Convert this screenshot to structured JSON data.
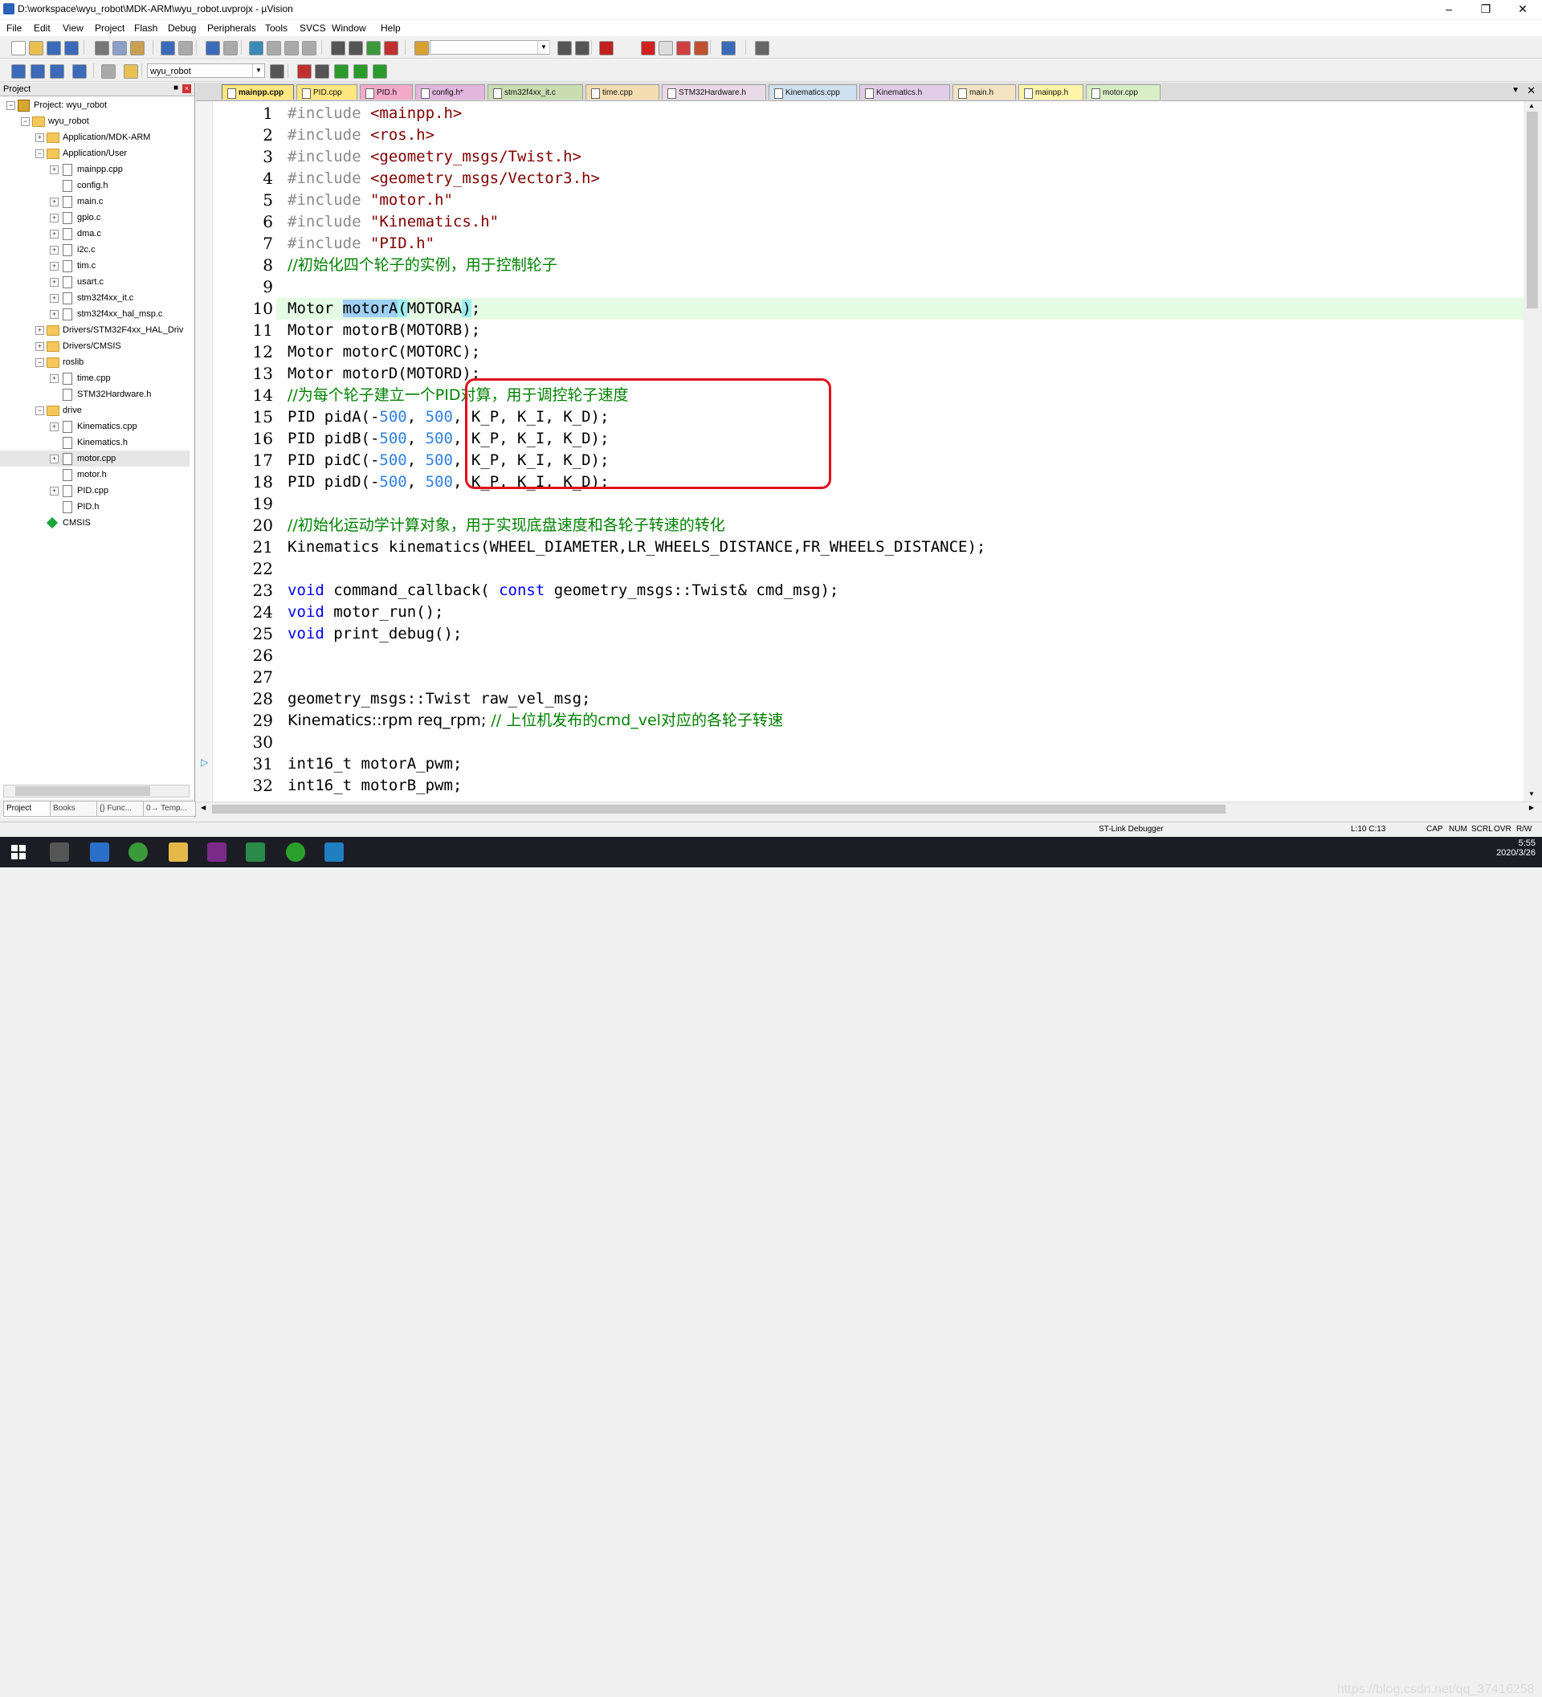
{
  "window": {
    "title": "D:\\workspace\\wyu_robot\\MDK-ARM\\wyu_robot.uvprojx - µVision"
  },
  "menu": [
    "File",
    "Edit",
    "View",
    "Project",
    "Flash",
    "Debug",
    "Peripherals",
    "Tools",
    "SVCS",
    "Window",
    "Help"
  ],
  "toolbar": {
    "target": "wyu_robot"
  },
  "project": {
    "header": "Project",
    "tree": [
      {
        "label": "Project: wyu_robot",
        "level": 0,
        "type": "project",
        "exp": "-"
      },
      {
        "label": "wyu_robot",
        "level": 1,
        "type": "folder",
        "exp": "-"
      },
      {
        "label": "Application/MDK-ARM",
        "level": 2,
        "type": "folder",
        "exp": "+"
      },
      {
        "label": "Application/User",
        "level": 2,
        "type": "folder",
        "exp": "-"
      },
      {
        "label": "mainpp.cpp",
        "level": 3,
        "type": "file",
        "exp": "+"
      },
      {
        "label": "config.h",
        "level": 3,
        "type": "file",
        "exp": ""
      },
      {
        "label": "main.c",
        "level": 3,
        "type": "file",
        "exp": "+"
      },
      {
        "label": "gpio.c",
        "level": 3,
        "type": "file",
        "exp": "+"
      },
      {
        "label": "dma.c",
        "level": 3,
        "type": "file",
        "exp": "+"
      },
      {
        "label": "i2c.c",
        "level": 3,
        "type": "file",
        "exp": "+"
      },
      {
        "label": "tim.c",
        "level": 3,
        "type": "file",
        "exp": "+"
      },
      {
        "label": "usart.c",
        "level": 3,
        "type": "file",
        "exp": "+"
      },
      {
        "label": "stm32f4xx_it.c",
        "level": 3,
        "type": "file",
        "exp": "+"
      },
      {
        "label": "stm32f4xx_hal_msp.c",
        "level": 3,
        "type": "file",
        "exp": "+"
      },
      {
        "label": "Drivers/STM32F4xx_HAL_Driv",
        "level": 2,
        "type": "folder",
        "exp": "+"
      },
      {
        "label": "Drivers/CMSIS",
        "level": 2,
        "type": "folder",
        "exp": "+"
      },
      {
        "label": "roslib",
        "level": 2,
        "type": "folder",
        "exp": "-"
      },
      {
        "label": "time.cpp",
        "level": 3,
        "type": "file",
        "exp": "+"
      },
      {
        "label": "STM32Hardware.h",
        "level": 3,
        "type": "file",
        "exp": ""
      },
      {
        "label": "drive",
        "level": 2,
        "type": "folder",
        "exp": "-"
      },
      {
        "label": "Kinematics.cpp",
        "level": 3,
        "type": "file",
        "exp": "+"
      },
      {
        "label": "Kinematics.h",
        "level": 3,
        "type": "file",
        "exp": ""
      },
      {
        "label": "motor.cpp",
        "level": 3,
        "type": "file",
        "exp": "+",
        "selected": true
      },
      {
        "label": "motor.h",
        "level": 3,
        "type": "file",
        "exp": ""
      },
      {
        "label": "PID.cpp",
        "level": 3,
        "type": "file",
        "exp": "+"
      },
      {
        "label": "PID.h",
        "level": 3,
        "type": "file",
        "exp": ""
      },
      {
        "label": "CMSIS",
        "level": 2,
        "type": "gem",
        "exp": ""
      }
    ],
    "tabs": [
      "Project",
      "Books",
      "{} Func...",
      "0→ Temp..."
    ]
  },
  "file_tabs": [
    {
      "label": "mainpp.cpp",
      "color": "#ffe680",
      "active": true
    },
    {
      "label": "PID.cpp",
      "color": "#ffe680"
    },
    {
      "label": "PID.h",
      "color": "#f5a9c8"
    },
    {
      "label": "config.h*",
      "color": "#e2b6de"
    },
    {
      "label": "stm32f4xx_it.c",
      "color": "#c9ddb0"
    },
    {
      "label": "time.cpp",
      "color": "#f4ddb0"
    },
    {
      "label": "STM32Hardware.h",
      "color": "#ead9e6"
    },
    {
      "label": "Kinematics.cpp",
      "color": "#cfe0f0"
    },
    {
      "label": "Kinematics.h",
      "color": "#e2cde8"
    },
    {
      "label": "main.h",
      "color": "#f4e4c2"
    },
    {
      "label": "mainpp.h",
      "color": "#fff5a8"
    },
    {
      "label": "motor.cpp",
      "color": "#d9eec6"
    }
  ],
  "code_lines": [
    {
      "n": "1",
      "segs": [
        [
          "pp",
          "#include "
        ],
        [
          "str",
          "<mainpp.h>"
        ]
      ]
    },
    {
      "n": "2",
      "segs": [
        [
          "pp",
          "#include "
        ],
        [
          "str",
          "<ros.h>"
        ]
      ]
    },
    {
      "n": "3",
      "segs": [
        [
          "pp",
          "#include "
        ],
        [
          "str",
          "<geometry_msgs/Twist.h>"
        ]
      ]
    },
    {
      "n": "4",
      "segs": [
        [
          "pp",
          "#include "
        ],
        [
          "str",
          "<geometry_msgs/Vector3.h>"
        ]
      ]
    },
    {
      "n": "5",
      "segs": [
        [
          "pp",
          "#include "
        ],
        [
          "str",
          "\"motor.h\""
        ]
      ]
    },
    {
      "n": "6",
      "segs": [
        [
          "pp",
          "#include "
        ],
        [
          "str",
          "\"Kinematics.h\""
        ]
      ]
    },
    {
      "n": "7",
      "segs": [
        [
          "pp",
          "#include "
        ],
        [
          "str",
          "\"PID.h\""
        ]
      ]
    },
    {
      "n": "8",
      "segs": [
        [
          "com",
          "//初始化四个轮子的实例，用于控制轮子"
        ]
      ]
    },
    {
      "n": "9",
      "segs": []
    },
    {
      "n": "10",
      "hl": true,
      "segs": [
        [
          "",
          "Motor "
        ],
        [
          "sel",
          "motorA"
        ],
        [
          "brkt",
          "("
        ],
        [
          "",
          "MOTORA"
        ],
        [
          "brkt",
          ")"
        ],
        [
          "",
          ";"
        ]
      ]
    },
    {
      "n": "11",
      "segs": [
        [
          "",
          "Motor motorB(MOTORB);"
        ]
      ]
    },
    {
      "n": "12",
      "segs": [
        [
          "",
          "Motor motorC(MOTORC);"
        ]
      ]
    },
    {
      "n": "13",
      "segs": [
        [
          "",
          "Motor motorD(MOTORD);"
        ]
      ]
    },
    {
      "n": "14",
      "segs": [
        [
          "com",
          "//为每个轮子建立一个PID对算，用于调控轮子速度"
        ]
      ]
    },
    {
      "n": "15",
      "segs": [
        [
          "",
          "PID pidA(-"
        ],
        [
          "num",
          "500"
        ],
        [
          "",
          ", "
        ],
        [
          "num",
          "500"
        ],
        [
          "",
          ", K_P, K_I, K_D);"
        ]
      ]
    },
    {
      "n": "16",
      "segs": [
        [
          "",
          "PID pidB(-"
        ],
        [
          "num",
          "500"
        ],
        [
          "",
          ", "
        ],
        [
          "num",
          "500"
        ],
        [
          "",
          ", K_P, K_I, K_D);"
        ]
      ]
    },
    {
      "n": "17",
      "segs": [
        [
          "",
          "PID pidC(-"
        ],
        [
          "num",
          "500"
        ],
        [
          "",
          ", "
        ],
        [
          "num",
          "500"
        ],
        [
          "",
          ", K_P, K_I, K_D);"
        ]
      ]
    },
    {
      "n": "18",
      "segs": [
        [
          "",
          "PID pidD(-"
        ],
        [
          "num",
          "500"
        ],
        [
          "",
          ", "
        ],
        [
          "num",
          "500"
        ],
        [
          "",
          ", K_P, K_I, K_D);"
        ]
      ]
    },
    {
      "n": "19",
      "segs": []
    },
    {
      "n": "20",
      "segs": [
        [
          "com",
          "//初始化运动学计算对象，用于实现底盘速度和各轮子转速的转化"
        ]
      ]
    },
    {
      "n": "21",
      "segs": [
        [
          "",
          "Kinematics kinematics(WHEEL_DIAMETER,LR_WHEELS_DISTANCE,FR_WHEELS_DISTANCE);"
        ]
      ]
    },
    {
      "n": "22",
      "segs": []
    },
    {
      "n": "23",
      "segs": [
        [
          "kw",
          "void"
        ],
        [
          "",
          " command_callback( "
        ],
        [
          "kw",
          "const"
        ],
        [
          "",
          " geometry_msgs::Twist& cmd_msg);"
        ]
      ]
    },
    {
      "n": "24",
      "segs": [
        [
          "kw",
          "void"
        ],
        [
          "",
          " motor_run();"
        ]
      ]
    },
    {
      "n": "25",
      "segs": [
        [
          "kw",
          "void"
        ],
        [
          "",
          " print_debug();"
        ]
      ]
    },
    {
      "n": "26",
      "segs": []
    },
    {
      "n": "27",
      "segs": []
    },
    {
      "n": "28",
      "segs": [
        [
          "",
          "geometry_msgs::Twist raw_vel_msg;"
        ]
      ]
    },
    {
      "n": "29",
      "segs": [
        [
          "",
          "Kinematics::rpm req_rpm; "
        ],
        [
          "com",
          "// 上位机发布的cmd_vel对应的各轮子转速"
        ]
      ]
    },
    {
      "n": "30",
      "segs": []
    },
    {
      "n": "31",
      "segs": [
        [
          "",
          "int16_t motorA_pwm;"
        ]
      ]
    },
    {
      "n": "32",
      "segs": [
        [
          "",
          "int16_t motorB_pwm;"
        ]
      ]
    }
  ],
  "status": {
    "debugger": "ST-Link Debugger",
    "position": "L:10 C:13",
    "indicators": [
      "CAP",
      "NUM",
      "SCRL",
      "OVR",
      "R/W"
    ]
  },
  "taskbar": {
    "time": "5:55",
    "date": "2020/3/26",
    "watermark": "https://blog.csdn.net/qq_37416258"
  }
}
